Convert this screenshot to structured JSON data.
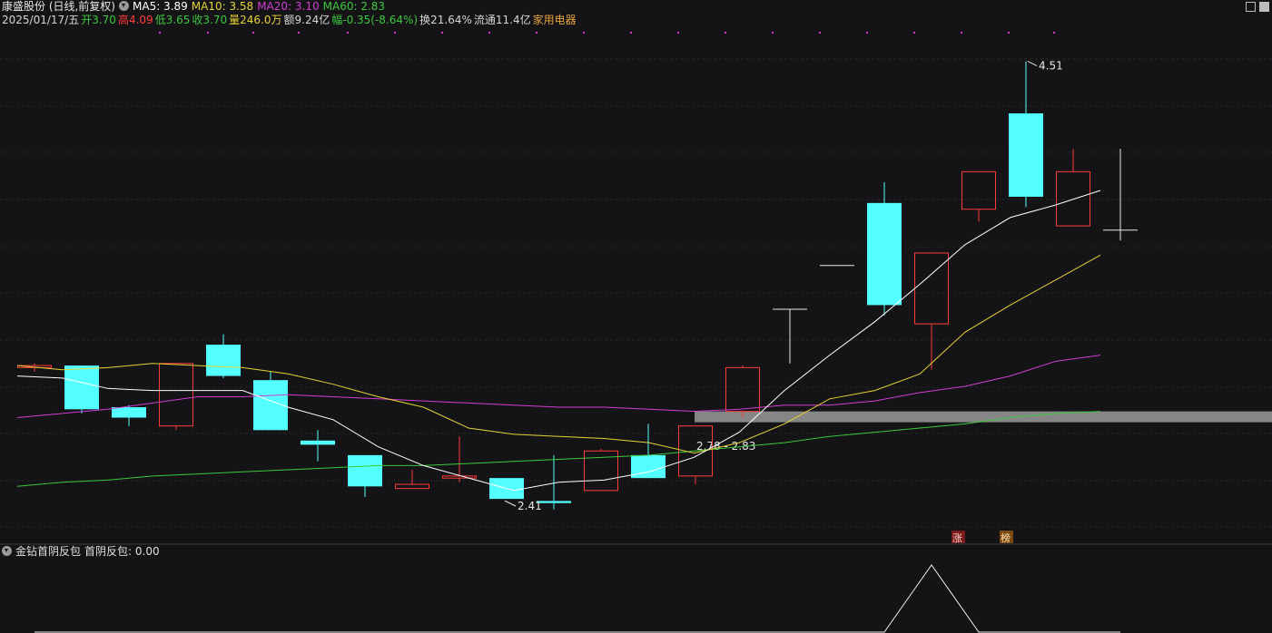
{
  "header": {
    "stock": "康盛股份 (日线,前复权)",
    "ma5": "MA5: 3.89",
    "ma10": "MA10: 3.58",
    "ma20": "MA20: 3.10",
    "ma60": "MA60: 2.83",
    "date": "2025/01/17/五",
    "open": "开3.70",
    "high": "高4.09",
    "low": "低3.65",
    "close": "收3.70",
    "volume": "量246.0万",
    "amount": "额9.24亿",
    "change": "幅-0.35(-8.64%)",
    "turnover": "换21.64%",
    "float": "流通11.4亿",
    "sector": "家用电器"
  },
  "colors": {
    "up": "#ff3b3b",
    "down": "#54ffff",
    "ma5": "#ffffff",
    "ma10": "#e6d234",
    "ma20": "#d23cd2",
    "ma60": "#3cc83c",
    "background": "#141417"
  },
  "chart_data": {
    "type": "candlestick",
    "price_range": [
      2.28,
      4.63
    ],
    "candles": [
      {
        "o": 3.04,
        "c": 3.05,
        "h": 3.06,
        "l": 3.02
      },
      {
        "o": 3.05,
        "c": 2.84,
        "h": 3.05,
        "l": 2.82
      },
      {
        "o": 2.85,
        "c": 2.8,
        "h": 2.86,
        "l": 2.76
      },
      {
        "o": 2.76,
        "c": 3.06,
        "h": 3.06,
        "l": 2.74
      },
      {
        "o": 3.15,
        "c": 3.0,
        "h": 3.2,
        "l": 2.99
      },
      {
        "o": 2.98,
        "c": 2.74,
        "h": 3.02,
        "l": 2.74
      },
      {
        "o": 2.69,
        "c": 2.67,
        "h": 2.74,
        "l": 2.59
      },
      {
        "o": 2.62,
        "c": 2.47,
        "h": 2.62,
        "l": 2.42
      },
      {
        "o": 2.46,
        "c": 2.48,
        "h": 2.55,
        "l": 2.46
      },
      {
        "o": 2.51,
        "c": 2.52,
        "h": 2.71,
        "l": 2.49
      },
      {
        "o": 2.51,
        "c": 2.41,
        "h": 2.51,
        "l": 2.41
      },
      {
        "o": 2.4,
        "c": 2.39,
        "h": 2.62,
        "l": 2.36
      },
      {
        "o": 2.45,
        "c": 2.64,
        "h": 2.65,
        "l": 2.45
      },
      {
        "o": 2.62,
        "c": 2.51,
        "h": 2.77,
        "l": 2.51
      },
      {
        "o": 2.52,
        "c": 2.76,
        "h": 2.76,
        "l": 2.48
      },
      {
        "o": 2.83,
        "c": 3.04,
        "h": 3.05,
        "l": 2.8
      },
      {
        "o": 3.32,
        "c": 3.32,
        "h": 3.32,
        "l": 3.06
      },
      {
        "o": 3.53,
        "c": 3.53,
        "h": 3.53,
        "l": 3.53
      },
      {
        "o": 3.83,
        "c": 3.34,
        "h": 3.93,
        "l": 3.29
      },
      {
        "o": 3.25,
        "c": 3.59,
        "h": 3.59,
        "l": 3.03
      },
      {
        "o": 3.8,
        "c": 3.98,
        "h": 3.98,
        "l": 3.74
      },
      {
        "o": 4.26,
        "c": 3.86,
        "h": 4.51,
        "l": 3.81
      },
      {
        "o": 3.72,
        "c": 3.98,
        "h": 4.09,
        "l": 3.72
      },
      {
        "o": 3.7,
        "c": 3.7,
        "h": 4.09,
        "l": 3.65
      }
    ],
    "ma5": [
      3.0,
      2.99,
      2.94,
      2.93,
      2.93,
      2.93,
      2.85,
      2.79,
      2.66,
      2.57,
      2.51,
      2.45,
      2.49,
      2.5,
      2.54,
      2.61,
      2.73,
      2.93,
      3.1,
      3.26,
      3.44,
      3.63,
      3.76,
      3.82,
      3.89
    ],
    "ma10": [
      3.05,
      3.03,
      3.04,
      3.06,
      3.05,
      3.04,
      3.01,
      2.96,
      2.9,
      2.85,
      2.75,
      2.72,
      2.71,
      2.7,
      2.68,
      2.63,
      2.68,
      2.77,
      2.89,
      2.93,
      3.01,
      3.21,
      3.34,
      3.46,
      3.58
    ],
    "ma20": [
      2.8,
      2.82,
      2.84,
      2.87,
      2.9,
      2.9,
      2.91,
      2.9,
      2.89,
      2.88,
      2.87,
      2.86,
      2.85,
      2.85,
      2.84,
      2.83,
      2.84,
      2.86,
      2.86,
      2.88,
      2.92,
      2.95,
      3.0,
      3.07,
      3.1
    ],
    "ma60": [
      2.47,
      2.49,
      2.5,
      2.52,
      2.53,
      2.54,
      2.55,
      2.56,
      2.57,
      2.57,
      2.58,
      2.59,
      2.6,
      2.61,
      2.62,
      2.64,
      2.66,
      2.68,
      2.71,
      2.73,
      2.75,
      2.77,
      2.8,
      2.82,
      2.83
    ],
    "annotations": {
      "high_label": "4.51",
      "low_label": "2.41",
      "band_label": "2.78 - 2.83",
      "band": [
        2.78,
        2.83
      ],
      "tag_zhang": "涨",
      "tag_bang": "榜"
    },
    "indicator": {
      "name": "金钻首阴反包",
      "value_label": "首阴反包: 0.00",
      "values": [
        0,
        0,
        0,
        0,
        0,
        0,
        0,
        0,
        0,
        0,
        0,
        0,
        0,
        0,
        0,
        0,
        0,
        0,
        0,
        1,
        0,
        0,
        0,
        0
      ]
    }
  }
}
